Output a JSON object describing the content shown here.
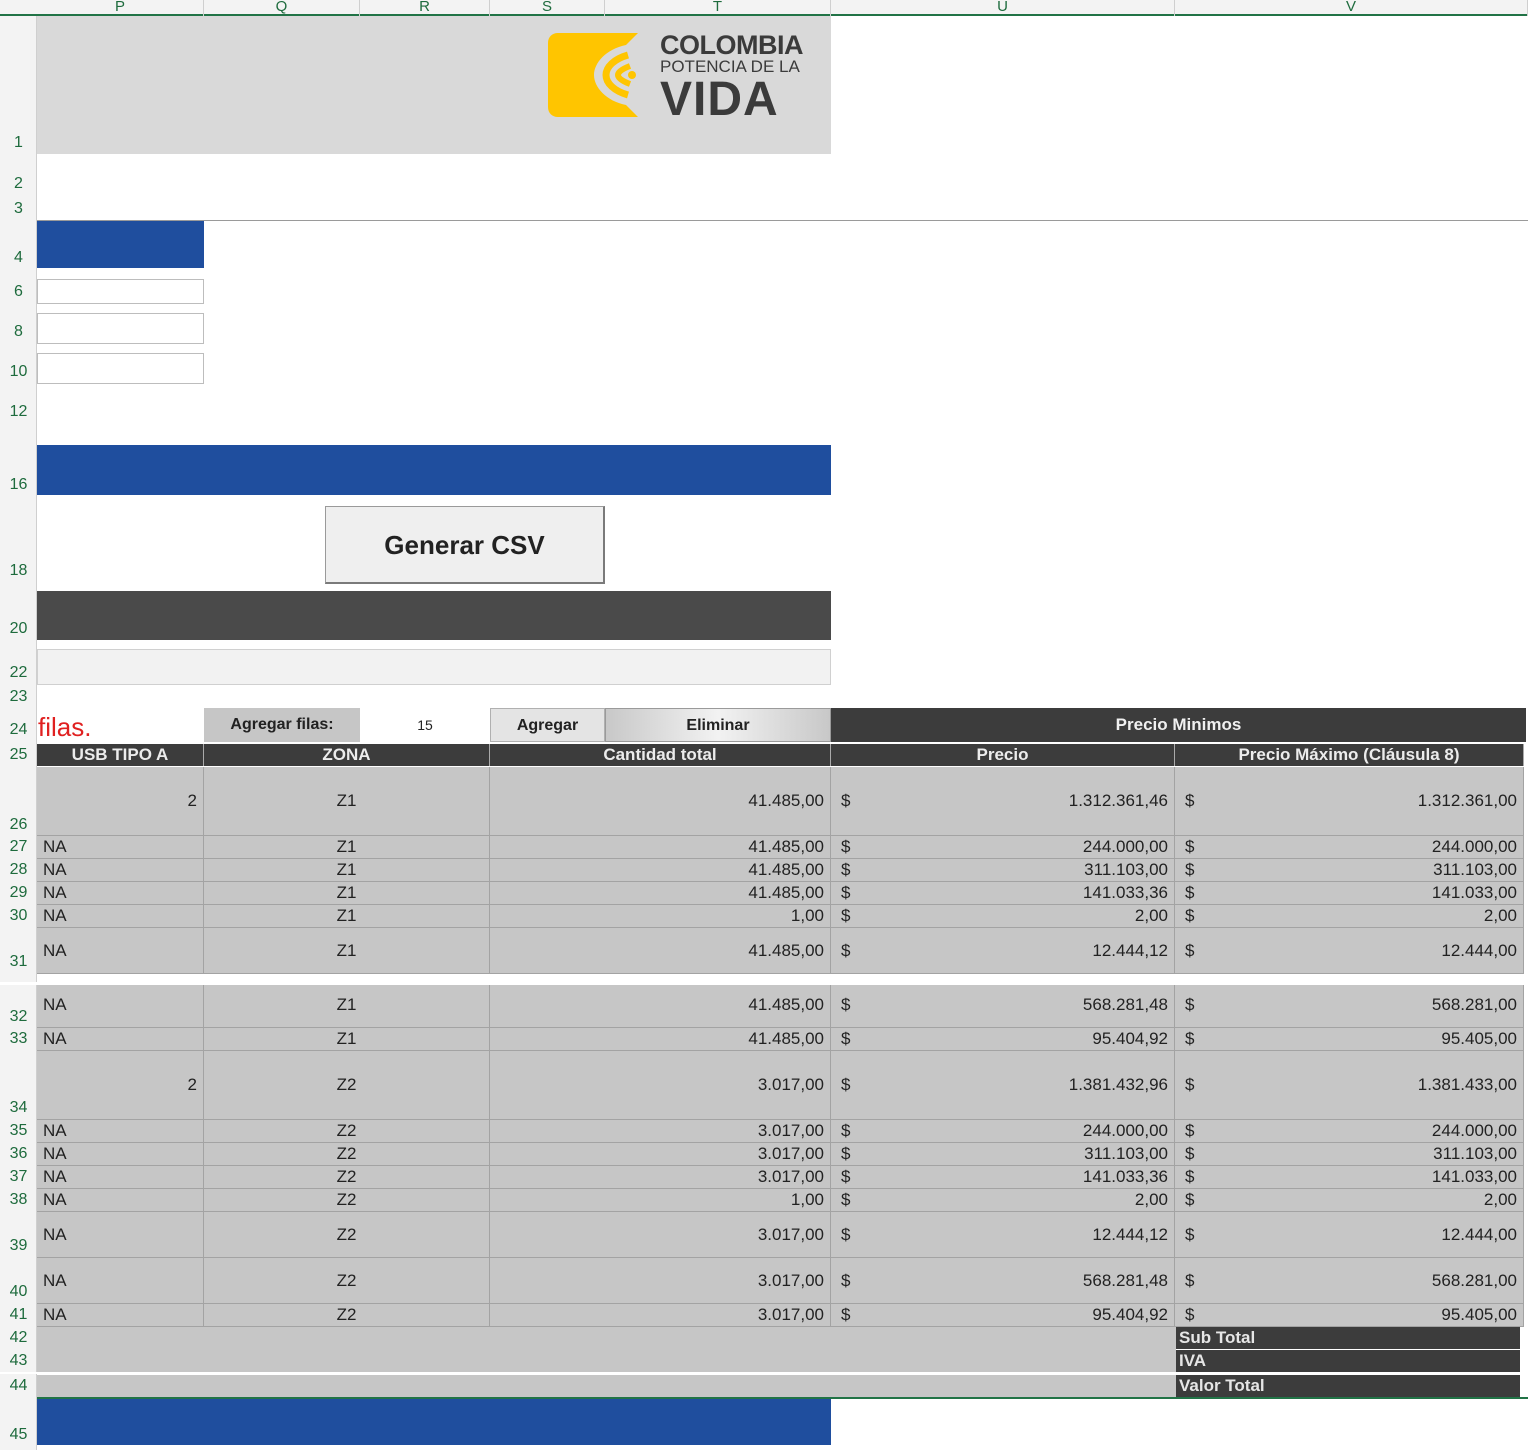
{
  "columns": [
    "P",
    "Q",
    "R",
    "S",
    "T",
    "U",
    "V"
  ],
  "rows_visible": [
    "1",
    "2",
    "3",
    "4",
    "6",
    "8",
    "10",
    "12",
    "16",
    "18",
    "20",
    "22",
    "23",
    "24",
    "25",
    "26",
    "27",
    "28",
    "29",
    "30",
    "31",
    "32",
    "33",
    "34",
    "35",
    "36",
    "37",
    "38",
    "39",
    "40",
    "41",
    "42",
    "43",
    "44",
    "45"
  ],
  "logo": {
    "line1": "COLOMBIA",
    "line2": "POTENCIA DE LA",
    "line3": "VIDA",
    "accent_color": "#FFC500"
  },
  "button": {
    "label": "Generar CSV"
  },
  "filas_note": "filas.",
  "controls": {
    "agregar_filas_label": "Agregar filas:",
    "agregar_filas_value": "15",
    "agregar_label": "Agregar",
    "eliminar_label": "Eliminar",
    "precio_minimos_label": "Precio Minimos"
  },
  "table": {
    "headers": [
      "USB TIPO A",
      "ZONA",
      "Cantidad total",
      "Precio",
      "Precio Máximo (Cláusula 8)"
    ],
    "currency": "$",
    "rows": [
      {
        "usb": "2",
        "zona": "Z1",
        "cantidad": "41.485,00",
        "precio": "1.312.361,46",
        "precio_max": "1.312.361,00"
      },
      {
        "usb": "NA",
        "zona": "Z1",
        "cantidad": "41.485,00",
        "precio": "244.000,00",
        "precio_max": "244.000,00"
      },
      {
        "usb": "NA",
        "zona": "Z1",
        "cantidad": "41.485,00",
        "precio": "311.103,00",
        "precio_max": "311.103,00"
      },
      {
        "usb": "NA",
        "zona": "Z1",
        "cantidad": "41.485,00",
        "precio": "141.033,36",
        "precio_max": "141.033,00"
      },
      {
        "usb": "NA",
        "zona": "Z1",
        "cantidad": "1,00",
        "precio": "2,00",
        "precio_max": "2,00"
      },
      {
        "usb": "NA",
        "zona": "Z1",
        "cantidad": "41.485,00",
        "precio": "12.444,12",
        "precio_max": "12.444,00"
      },
      {
        "usb": "NA",
        "zona": "Z1",
        "cantidad": "41.485,00",
        "precio": "568.281,48",
        "precio_max": "568.281,00"
      },
      {
        "usb": "NA",
        "zona": "Z1",
        "cantidad": "41.485,00",
        "precio": "95.404,92",
        "precio_max": "95.405,00"
      },
      {
        "usb": "2",
        "zona": "Z2",
        "cantidad": "3.017,00",
        "precio": "1.381.432,96",
        "precio_max": "1.381.433,00"
      },
      {
        "usb": "NA",
        "zona": "Z2",
        "cantidad": "3.017,00",
        "precio": "244.000,00",
        "precio_max": "244.000,00"
      },
      {
        "usb": "NA",
        "zona": "Z2",
        "cantidad": "3.017,00",
        "precio": "311.103,00",
        "precio_max": "311.103,00"
      },
      {
        "usb": "NA",
        "zona": "Z2",
        "cantidad": "3.017,00",
        "precio": "141.033,36",
        "precio_max": "141.033,00"
      },
      {
        "usb": "NA",
        "zona": "Z2",
        "cantidad": "1,00",
        "precio": "2,00",
        "precio_max": "2,00"
      },
      {
        "usb": "NA",
        "zona": "Z2",
        "cantidad": "3.017,00",
        "precio": "12.444,12",
        "precio_max": "12.444,00"
      },
      {
        "usb": "NA",
        "zona": "Z2",
        "cantidad": "3.017,00",
        "precio": "568.281,48",
        "precio_max": "568.281,00"
      },
      {
        "usb": "NA",
        "zona": "Z2",
        "cantidad": "3.017,00",
        "precio": "95.404,92",
        "precio_max": "95.405,00"
      }
    ]
  },
  "summary": {
    "sub_total": "Sub Total",
    "iva": "IVA",
    "valor_total": "Valor Total"
  },
  "colors": {
    "blue_band": "#1F4E9E",
    "dark_band": "#4A4A4A",
    "table_header": "#3C3C3C",
    "cell_gray": "#C6C6C6",
    "header_green": "#1E6B3D",
    "note_red": "#E02020"
  }
}
